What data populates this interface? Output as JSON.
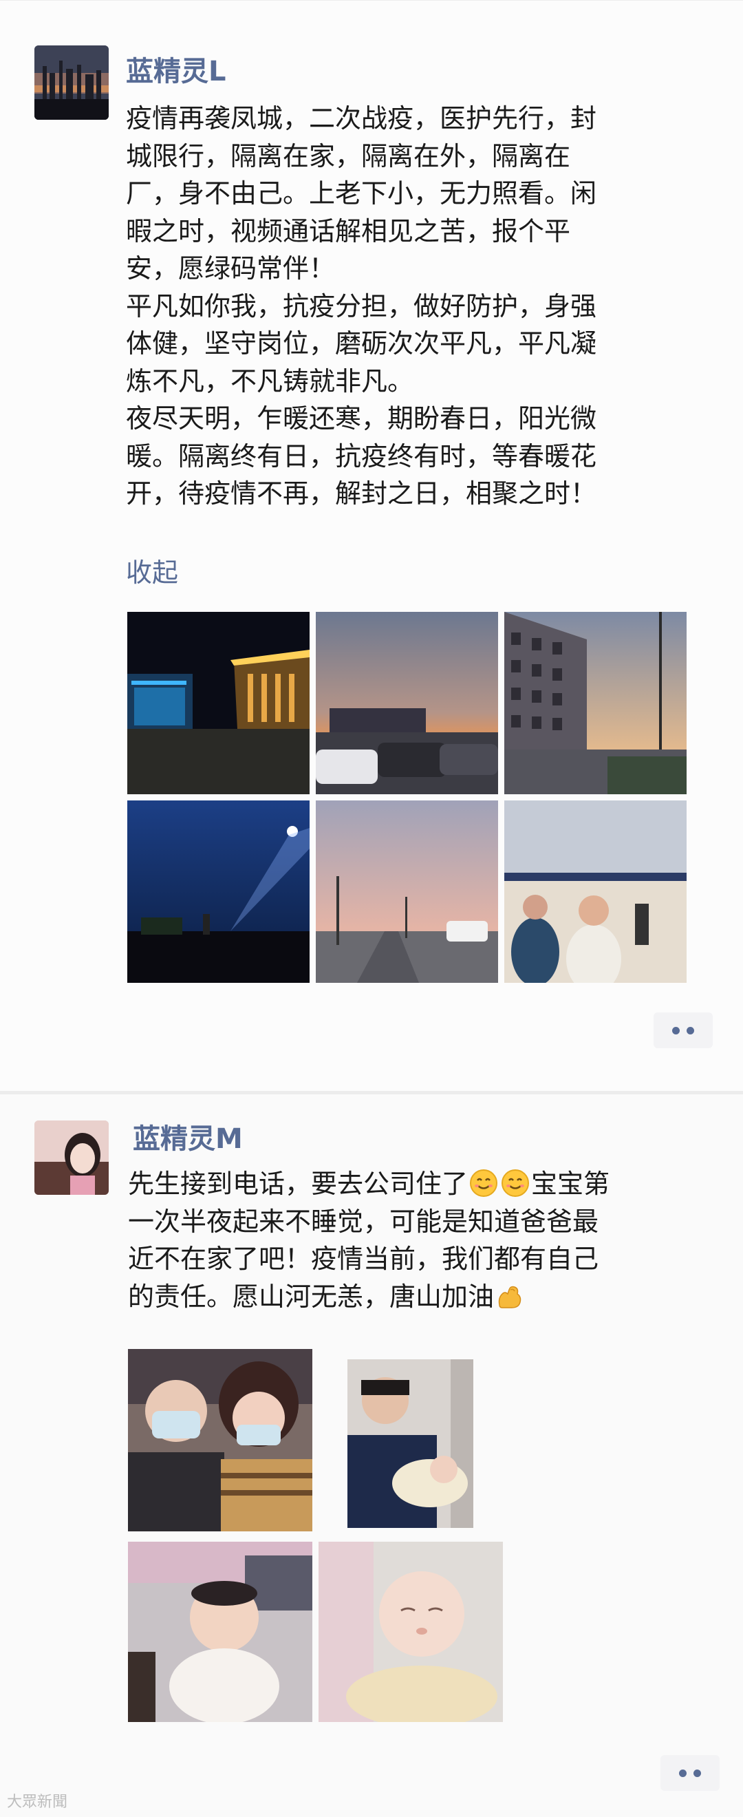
{
  "posts": [
    {
      "username": "蓝精灵L",
      "lines": [
        "疫情再袭凤城，二次战疫，医护先行，封",
        "城限行，隔离在家，隔离在外，隔离在",
        "厂，身不由己。上老下小，无力照看。闲",
        "暇之时，视频通话解相见之苦，报个平",
        "安，愿绿码常伴！",
        "平凡如你我，抗疫分担，做好防护，身强",
        "体健，坚守岗位，磨砺次次平凡，平凡凝",
        "炼不凡，不凡铸就非凡。",
        "夜尽天明，乍暖还寒，期盼春日，阳光微",
        "暖。隔离终有日，抗疫终有时，等春暖花",
        "开，待疫情不再，解封之日，相聚之时！"
      ],
      "collapse_label": "收起",
      "photos": [
        "night-building-photo",
        "sunset-parking-lot-photo",
        "apartment-street-photo",
        "night-sky-searchlight-photo",
        "dawn-road-photo",
        "queue-beach-photo"
      ]
    },
    {
      "username": "蓝精灵M",
      "lines": [
        "先生接到电话，要去公司住了",
        "一次半夜起来不睡觉，可能是知道爸爸最",
        "近不在家了吧！疫情当前，我们都有自己",
        "的责任。愿山河无恙，唐山加油"
      ],
      "line1_suffix": "宝宝第",
      "emojis": [
        "smile-emoji-icon",
        "smile-emoji-icon",
        "flexed-biceps-emoji-icon"
      ],
      "photos": [
        "couple-selfie-photo",
        "father-baby-photo",
        "baby-awake-photo",
        "baby-sleeping-photo"
      ]
    }
  ],
  "watermark": "大眾新聞",
  "colors": {
    "username": "#576b95",
    "link": "#576b95",
    "text": "#1a1a1a",
    "background": "#ffffff",
    "divider": "#ececec"
  }
}
